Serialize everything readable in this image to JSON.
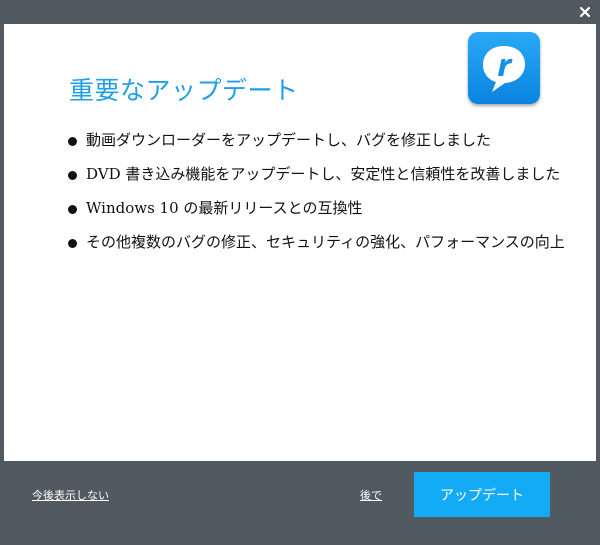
{
  "dialog": {
    "title": "重要なアップデート",
    "close_icon": "close-icon",
    "logo_icon": "realplayer-logo"
  },
  "features": [
    "動画ダウンローダーをアップデートし、バグを修正しました",
    "DVD 書き込み機能をアップデートし、安定性と信頼性を改善しました",
    "Windows 10 の最新リリースとの互換性",
    "その他複数のバグの修正、セキュリティの強化、パフォーマンスの向上"
  ],
  "footer": {
    "dont_show_label": "今後表示しない",
    "later_label": "後で",
    "update_label": "アップデート"
  },
  "colors": {
    "accent": "#1e9fe8",
    "button": "#13aaf6",
    "frame": "#525a61"
  }
}
